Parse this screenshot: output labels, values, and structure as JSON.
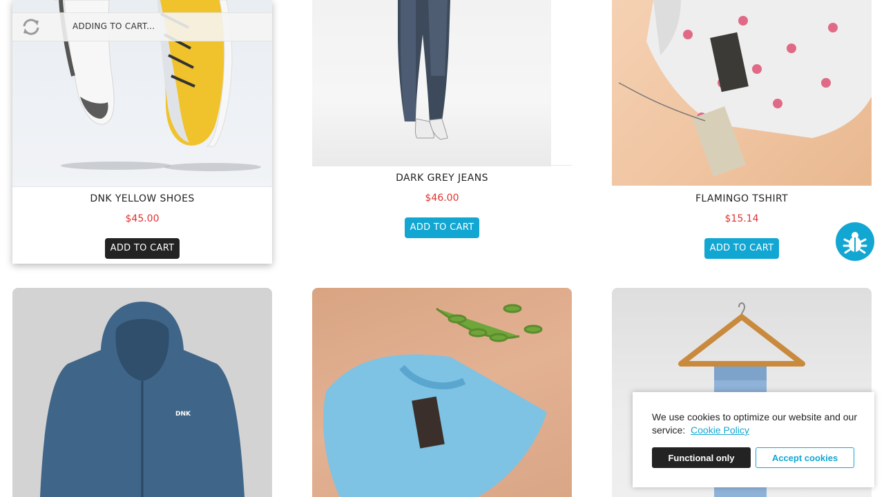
{
  "products": [
    {
      "name": "DNK Yellow Shoes",
      "price": "$45.00",
      "button": "ADD TO CART",
      "status": "ADDING TO CART...",
      "image": "yellow-shoes-image"
    },
    {
      "name": "Dark Grey Jeans",
      "price": "$46.00",
      "button": "ADD TO CART",
      "image": "grey-jeans-image"
    },
    {
      "name": "Flamingo Tshirt",
      "price": "$15.14",
      "button": "ADD TO CART",
      "image": "flamingo-tshirt-image"
    },
    {
      "image": "blue-hoodie-image"
    },
    {
      "image": "blue-tshirt-image"
    },
    {
      "image": "jeans-on-hanger-image"
    }
  ],
  "bug_button": {
    "icon": "bug-icon"
  },
  "cookie_banner": {
    "message": "We use cookies to optimize our website and our service:",
    "link": "Cookie Policy",
    "functional_button": "Functional only",
    "accept_button": "Accept cookies"
  },
  "colors": {
    "accent": "#12a6d2",
    "price": "#e0312f",
    "dark_button": "#232323"
  }
}
